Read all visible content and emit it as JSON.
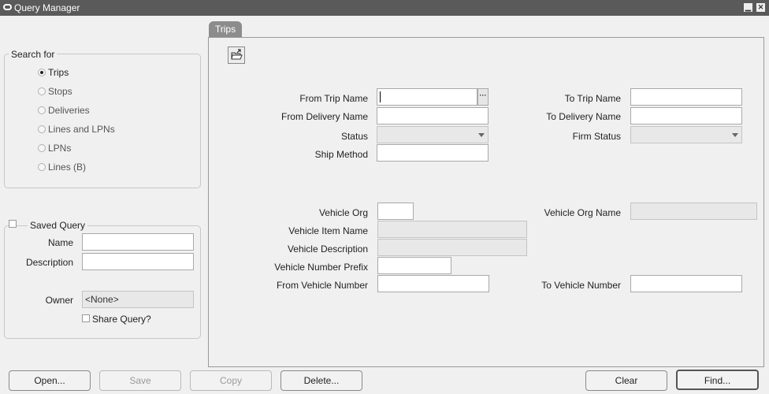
{
  "window": {
    "title": "Query Manager"
  },
  "search_for": {
    "legend": "Search for",
    "options": [
      "Trips",
      "Stops",
      "Deliveries",
      "Lines and LPNs",
      "LPNs",
      "Lines (B)"
    ],
    "selected": "Trips"
  },
  "saved_query": {
    "label": "Saved Query",
    "checked": false,
    "name_label": "Name",
    "name_value": "",
    "description_label": "Description",
    "description_value": "",
    "owner_label": "Owner",
    "owner_value": "<None>",
    "share_label": "Share Query?",
    "share_checked": false
  },
  "tab": {
    "label": "Trips"
  },
  "fields": {
    "from_trip_name": {
      "label": "From Trip Name",
      "value": ""
    },
    "to_trip_name": {
      "label": "To Trip Name",
      "value": ""
    },
    "from_delivery_name": {
      "label": "From Delivery Name",
      "value": ""
    },
    "to_delivery_name": {
      "label": "To Delivery Name",
      "value": ""
    },
    "status": {
      "label": "Status",
      "value": ""
    },
    "firm_status": {
      "label": "Firm Status",
      "value": ""
    },
    "ship_method": {
      "label": "Ship Method",
      "value": ""
    },
    "vehicle_org": {
      "label": "Vehicle Org",
      "value": ""
    },
    "vehicle_org_name": {
      "label": "Vehicle Org Name",
      "value": ""
    },
    "vehicle_item_name": {
      "label": "Vehicle Item Name",
      "value": ""
    },
    "vehicle_description": {
      "label": "Vehicle Description",
      "value": ""
    },
    "vehicle_number_prefix": {
      "label": "Vehicle Number Prefix",
      "value": ""
    },
    "from_vehicle_number": {
      "label": "From Vehicle Number",
      "value": ""
    },
    "to_vehicle_number": {
      "label": "To Vehicle Number",
      "value": ""
    }
  },
  "buttons": {
    "open": "Open...",
    "save": "Save",
    "copy": "Copy",
    "delete": "Delete...",
    "clear": "Clear",
    "find": "Find..."
  },
  "icons": {
    "folder": "open-folder-icon",
    "lov": "ellipsis-icon"
  }
}
